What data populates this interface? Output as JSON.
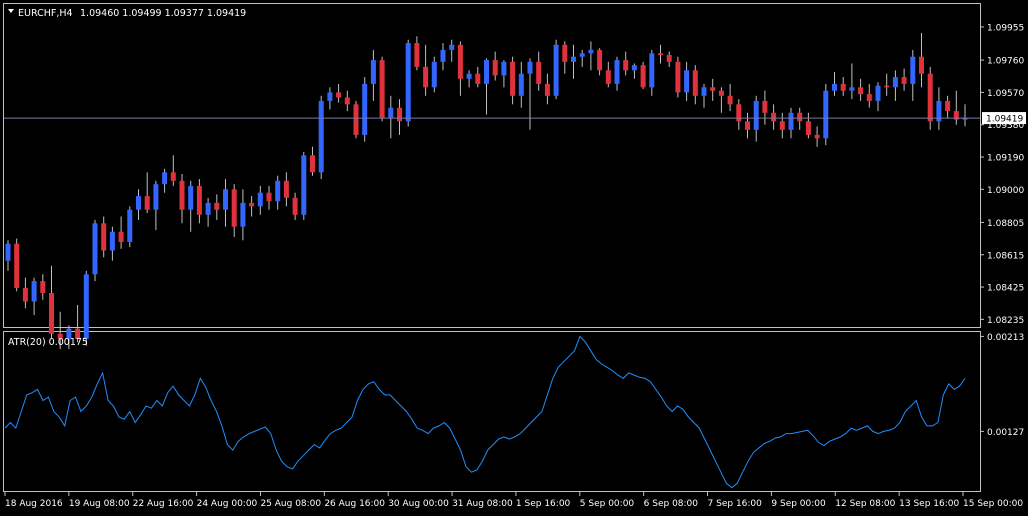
{
  "symbol_header": {
    "symbol": "EURCHF,H4",
    "quote": "1.09460 1.09499 1.09377 1.09419",
    "menu_icon": "triangle-down-icon"
  },
  "colors": {
    "background": "#000000",
    "frame": "#c0c0c0",
    "bull": "#3366ff",
    "bear": "#e0323c",
    "wick": "#c0c0c0",
    "indicator_line": "#1e90ff",
    "price_line": "#7a7aa8",
    "price_tag_bg": "#ffffff",
    "price_tag_text": "#000000"
  },
  "indicator": {
    "label": "ATR(20) 0.00175"
  },
  "current_price": "1.09419",
  "chart_data": [
    {
      "type": "candlestick",
      "title": "EURCHF,H4",
      "ylim": [
        1.0819,
        1.1009
      ],
      "yticks": [
        "1.09955",
        "1.09760",
        "1.09570",
        "1.09380",
        "1.09190",
        "1.09000",
        "1.08805",
        "1.08615",
        "1.08425",
        "1.08235"
      ],
      "xticks": [
        "18 Aug 2016",
        "19 Aug 08:00",
        "22 Aug 16:00",
        "24 Aug 00:00",
        "25 Aug 08:00",
        "26 Aug 16:00",
        "30 Aug 00:00",
        "31 Aug 08:00",
        "1 Sep 16:00",
        "5 Sep 00:00",
        "6 Sep 08:00",
        "7 Sep 16:00",
        "9 Sep 00:00",
        "12 Sep 08:00",
        "13 Sep 16:00",
        "15 Sep 00:00"
      ],
      "last_price": 1.09419,
      "grid": false,
      "ohlc": [
        [
          1.0858,
          1.087,
          1.0852,
          1.0868
        ],
        [
          1.0868,
          1.0871,
          1.084,
          1.0842
        ],
        [
          1.0842,
          1.0848,
          1.083,
          1.0834
        ],
        [
          1.0834,
          1.0848,
          1.0826,
          1.0846
        ],
        [
          1.0846,
          1.085,
          1.0835,
          1.0839
        ],
        [
          1.0839,
          1.0855,
          1.0812,
          1.0815
        ],
        [
          1.0815,
          1.0828,
          1.0806,
          1.0812
        ],
        [
          1.0812,
          1.082,
          1.0806,
          1.0818
        ],
        [
          1.0818,
          1.0832,
          1.081,
          1.0812
        ],
        [
          1.0812,
          1.0852,
          1.0808,
          1.085
        ],
        [
          1.085,
          1.0882,
          1.0846,
          1.088
        ],
        [
          1.088,
          1.0884,
          1.086,
          1.0864
        ],
        [
          1.0864,
          1.0878,
          1.0858,
          1.0875
        ],
        [
          1.0875,
          1.0884,
          1.0865,
          1.0869
        ],
        [
          1.0869,
          1.089,
          1.0866,
          1.0888
        ],
        [
          1.0888,
          1.09,
          1.0882,
          1.0896
        ],
        [
          1.0896,
          1.091,
          1.0886,
          1.0888
        ],
        [
          1.0888,
          1.0905,
          1.0876,
          1.0903
        ],
        [
          1.0903,
          1.0912,
          1.0898,
          1.091
        ],
        [
          1.091,
          1.092,
          1.0902,
          1.0905
        ],
        [
          1.0905,
          1.0909,
          1.088,
          1.0888
        ],
        [
          1.0888,
          1.0905,
          1.0875,
          1.0902
        ],
        [
          1.0902,
          1.0906,
          1.088,
          1.0885
        ],
        [
          1.0885,
          1.0895,
          1.0878,
          1.0892
        ],
        [
          1.0892,
          1.0897,
          1.0882,
          1.0888
        ],
        [
          1.0888,
          1.0906,
          1.0878,
          1.09
        ],
        [
          1.09,
          1.0903,
          1.0872,
          1.0878
        ],
        [
          1.0878,
          1.09,
          1.087,
          1.0892
        ],
        [
          1.0892,
          1.0896,
          1.0884,
          1.089
        ],
        [
          1.089,
          1.0902,
          1.0885,
          1.0898
        ],
        [
          1.0898,
          1.0902,
          1.0888,
          1.0893
        ],
        [
          1.0893,
          1.0908,
          1.0888,
          1.0905
        ],
        [
          1.0905,
          1.091,
          1.089,
          1.0895
        ],
        [
          1.0895,
          1.0898,
          1.0882,
          1.0885
        ],
        [
          1.0885,
          1.0922,
          1.0882,
          1.092
        ],
        [
          1.092,
          1.0925,
          1.0908,
          1.091
        ],
        [
          1.091,
          1.0955,
          1.0906,
          1.0952
        ],
        [
          1.0952,
          1.096,
          1.0947,
          1.0957
        ],
        [
          1.0957,
          1.0962,
          1.0951,
          1.0954
        ],
        [
          1.0954,
          1.0958,
          1.0946,
          1.095
        ],
        [
          1.095,
          1.0952,
          1.093,
          1.0932
        ],
        [
          1.0932,
          1.0966,
          1.0928,
          1.0962
        ],
        [
          1.0962,
          1.0982,
          1.0952,
          1.0976
        ],
        [
          1.0976,
          1.0978,
          1.094,
          1.0942
        ],
        [
          1.0942,
          1.0955,
          1.093,
          1.0948
        ],
        [
          1.0948,
          1.0953,
          1.0932,
          1.094
        ],
        [
          1.094,
          1.0988,
          1.0937,
          1.0986
        ],
        [
          1.0986,
          1.099,
          1.097,
          1.0972
        ],
        [
          1.0972,
          1.0985,
          1.0955,
          1.096
        ],
        [
          1.096,
          1.0978,
          1.0957,
          1.0975
        ],
        [
          1.0975,
          1.0986,
          1.097,
          1.0982
        ],
        [
          1.0982,
          1.0988,
          1.0975,
          1.0985
        ],
        [
          1.0985,
          1.0987,
          1.0955,
          1.0965
        ],
        [
          1.0965,
          1.097,
          1.096,
          1.0968
        ],
        [
          1.0968,
          1.0972,
          1.096,
          1.0962
        ],
        [
          1.0962,
          1.0977,
          1.0944,
          1.0976
        ],
        [
          1.0976,
          1.0981,
          1.0964,
          1.0967
        ],
        [
          1.0967,
          1.0976,
          1.096,
          1.0975
        ],
        [
          1.0975,
          1.0978,
          1.095,
          1.0955
        ],
        [
          1.0955,
          1.0975,
          1.0948,
          1.0968
        ],
        [
          1.0968,
          1.0977,
          1.0935,
          1.0975
        ],
        [
          1.0975,
          1.0981,
          1.0958,
          1.0962
        ],
        [
          1.0962,
          1.0968,
          1.095,
          1.0955
        ],
        [
          1.0955,
          1.0988,
          1.0953,
          1.0985
        ],
        [
          1.0985,
          1.0987,
          1.0968,
          1.0975
        ],
        [
          1.0975,
          1.0985,
          1.0965,
          1.0978
        ],
        [
          1.0978,
          1.0982,
          1.0972,
          1.098
        ],
        [
          1.098,
          1.0987,
          1.097,
          1.0982
        ],
        [
          1.0982,
          1.0983,
          1.0967,
          1.097
        ],
        [
          1.097,
          1.0975,
          1.096,
          1.0962
        ],
        [
          1.0962,
          1.0978,
          1.0958,
          1.0976
        ],
        [
          1.0976,
          1.0981,
          1.0967,
          1.097
        ],
        [
          1.097,
          1.0974,
          1.0965,
          1.0973
        ],
        [
          1.0973,
          1.0975,
          1.0959,
          1.096
        ],
        [
          1.096,
          1.0982,
          1.0955,
          1.098
        ],
        [
          1.098,
          1.0985,
          1.0974,
          1.0979
        ],
        [
          1.0979,
          1.0981,
          1.0972,
          1.0975
        ],
        [
          1.0975,
          1.0978,
          1.0954,
          1.0957
        ],
        [
          1.0957,
          1.0975,
          1.0952,
          1.097
        ],
        [
          1.097,
          1.0973,
          1.095,
          1.0955
        ],
        [
          1.0955,
          1.0962,
          1.0948,
          1.096
        ],
        [
          1.096,
          1.0965,
          1.0952,
          1.0958
        ],
        [
          1.0958,
          1.096,
          1.0945,
          1.0955
        ],
        [
          1.0955,
          1.0962,
          1.0946,
          1.095
        ],
        [
          1.095,
          1.0953,
          1.0935,
          1.094
        ],
        [
          1.094,
          1.0945,
          1.093,
          1.0935
        ],
        [
          1.0935,
          1.0955,
          1.0928,
          1.0952
        ],
        [
          1.0952,
          1.0958,
          1.0938,
          1.0945
        ],
        [
          1.0945,
          1.095,
          1.0935,
          1.094
        ],
        [
          1.094,
          1.0945,
          1.093,
          1.0935
        ],
        [
          1.0935,
          1.0948,
          1.093,
          1.0945
        ],
        [
          1.0945,
          1.0948,
          1.0935,
          1.094
        ],
        [
          1.094,
          1.0945,
          1.093,
          1.0932
        ],
        [
          1.0932,
          1.0937,
          1.0925,
          1.093
        ],
        [
          1.093,
          1.0962,
          1.0926,
          1.0958
        ],
        [
          1.0958,
          1.0969,
          1.0955,
          1.0962
        ],
        [
          1.0962,
          1.0966,
          1.0955,
          1.0958
        ],
        [
          1.0958,
          1.0974,
          1.0953,
          1.096
        ],
        [
          1.096,
          1.0965,
          1.0952,
          1.0956
        ],
        [
          1.0956,
          1.0962,
          1.0948,
          1.0952
        ],
        [
          1.0952,
          1.0963,
          1.0946,
          1.0961
        ],
        [
          1.0961,
          1.0968,
          1.0955,
          1.096
        ],
        [
          1.096,
          1.097,
          1.0952,
          1.0966
        ],
        [
          1.0966,
          1.0971,
          1.0958,
          1.0962
        ],
        [
          1.0962,
          1.0982,
          1.0952,
          1.0978
        ],
        [
          1.0978,
          1.0992,
          1.096,
          1.0968
        ],
        [
          1.0968,
          1.0972,
          1.0935,
          1.094
        ],
        [
          1.094,
          1.096,
          1.0935,
          1.0952
        ],
        [
          1.0952,
          1.0955,
          1.0942,
          1.0946
        ],
        [
          1.0946,
          1.0958,
          1.0938,
          1.0941
        ],
        [
          1.0941,
          1.095,
          1.0937,
          1.0942
        ]
      ],
      "series": [
        {
          "values": [
            0.0013,
            0.00135,
            0.0013,
            0.00145,
            0.0016,
            0.00162,
            0.00165,
            0.00155,
            0.00158,
            0.00145,
            0.0014,
            0.00132,
            0.00155,
            0.00158,
            0.00145,
            0.0015,
            0.00158,
            0.0017,
            0.0018,
            0.00155,
            0.0015,
            0.0014,
            0.00138,
            0.00145,
            0.00135,
            0.00142,
            0.0015,
            0.00148,
            0.00155,
            0.0015,
            0.00162,
            0.00168,
            0.0016,
            0.00155,
            0.0015,
            0.0016,
            0.00175,
            0.00167,
            0.00155,
            0.00145,
            0.00132,
            0.00115,
            0.0011,
            0.00118,
            0.00122,
            0.00125,
            0.00127,
            0.00129,
            0.00131,
            0.00125,
            0.0011,
            0.001,
            0.00095,
            0.00093,
            0.001,
            0.00105,
            0.0011,
            0.00115,
            0.00112,
            0.00119,
            0.00125,
            0.00128,
            0.0013,
            0.00135,
            0.0014,
            0.00155,
            0.00165,
            0.0017,
            0.00172,
            0.00165,
            0.0016,
            0.0016,
            0.00155,
            0.0015,
            0.00145,
            0.00138,
            0.0013,
            0.00128,
            0.00125,
            0.0013,
            0.00132,
            0.00135,
            0.0013,
            0.0012,
            0.0011,
            0.00095,
            0.0009,
            0.00092,
            0.001,
            0.0011,
            0.00115,
            0.0012,
            0.00122,
            0.0012,
            0.00122,
            0.00125,
            0.0013,
            0.00135,
            0.0014,
            0.00145,
            0.0016,
            0.00175,
            0.00185,
            0.0019,
            0.00195,
            0.002,
            0.00213,
            0.00208,
            0.002,
            0.00192,
            0.00188,
            0.00185,
            0.00182,
            0.00178,
            0.00175,
            0.0018,
            0.00178,
            0.00176,
            0.00175,
            0.00172,
            0.00165,
            0.00158,
            0.0015,
            0.00145,
            0.0015,
            0.00147,
            0.0014,
            0.00135,
            0.0013,
            0.0012,
            0.0011,
            0.001,
            0.0009,
            0.0008,
            0.00076,
            0.0008,
            0.0009,
            0.001,
            0.00108,
            0.00112,
            0.00116,
            0.00118,
            0.00121,
            0.00122,
            0.00125,
            0.00125,
            0.00126,
            0.00127,
            0.00128,
            0.00123,
            0.00117,
            0.00114,
            0.00118,
            0.0012,
            0.00122,
            0.00125,
            0.0013,
            0.00128,
            0.0013,
            0.00132,
            0.00127,
            0.00125,
            0.00127,
            0.00128,
            0.0013,
            0.00135,
            0.00145,
            0.0015,
            0.00155,
            0.0014,
            0.00132,
            0.00132,
            0.00135,
            0.0016,
            0.0017,
            0.00165,
            0.00168,
            0.00175
          ]
        }
      ]
    },
    {
      "type": "line",
      "title": "ATR(20) 0.00175",
      "ylim": [
        0.00073,
        0.00217
      ],
      "yticks": [
        "0.00213",
        "0.00127"
      ],
      "grid": false
    }
  ]
}
